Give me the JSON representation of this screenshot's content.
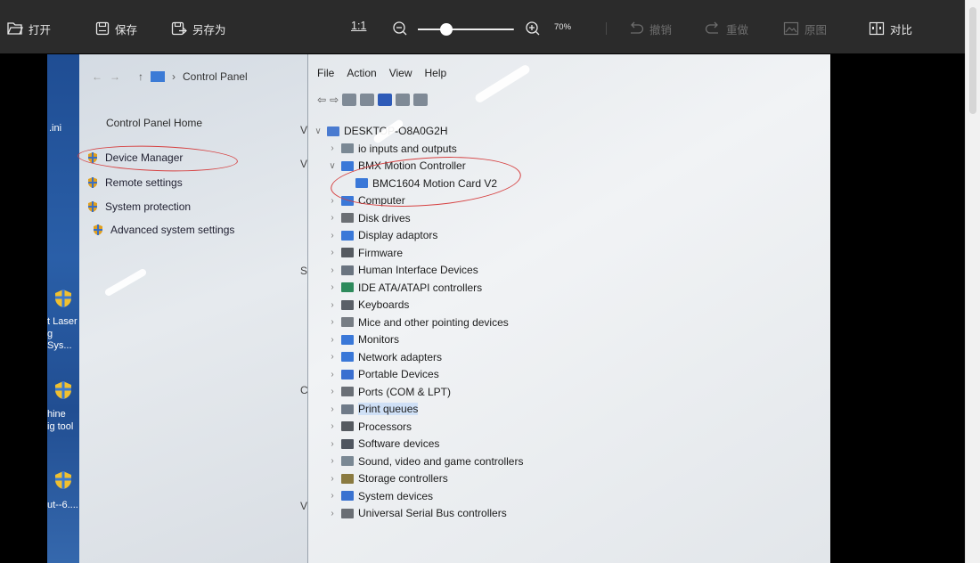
{
  "toolbar": {
    "open_label": "打开",
    "save_label": "保存",
    "save_as_label": "另存为",
    "ratio_label": "1:1",
    "zoom_percent": "70%",
    "zoom_level": 0.3,
    "undo_label": "撤销",
    "redo_label": "重做",
    "original_label": "原图",
    "compare_label": "对比"
  },
  "photo": {
    "desktop_labels": [
      ".ini",
      "t Laser",
      "g Sys...",
      "hine",
      "ig tool",
      "ut--6...."
    ],
    "control_panel": {
      "nav_path": "Control Panel",
      "home": "Control Panel Home",
      "links": [
        "Device Manager",
        "Remote settings",
        "System protection",
        "Advanced system settings"
      ],
      "edge_letters": [
        "V",
        "V",
        "S",
        "C",
        "V"
      ]
    },
    "device_manager": {
      "menu": [
        "File",
        "Action",
        "View",
        "Help"
      ],
      "tree": [
        {
          "label": "DESKTOP-O8A0G2H",
          "chev": "v",
          "indent": 0,
          "icon": "computer"
        },
        {
          "label": "    io inputs and outputs",
          "chev": ">",
          "indent": 1,
          "icon": "audio"
        },
        {
          "label": "BMX Motion Controller",
          "chev": "v",
          "indent": 1,
          "icon": "monitor"
        },
        {
          "label": "BMC1604 Motion Card V2",
          "chev": "",
          "indent": 2,
          "icon": "monitor"
        },
        {
          "label": "Computer",
          "chev": ">",
          "indent": 1,
          "icon": "monitor"
        },
        {
          "label": "Disk drives",
          "chev": ">",
          "indent": 1,
          "icon": "disk"
        },
        {
          "label": "Display adaptors",
          "chev": ">",
          "indent": 1,
          "icon": "monitor"
        },
        {
          "label": "Firmware",
          "chev": ">",
          "indent": 1,
          "icon": "chip"
        },
        {
          "label": "Human Interface Devices",
          "chev": ">",
          "indent": 1,
          "icon": "hid"
        },
        {
          "label": "IDE ATA/ATAPI controllers",
          "chev": ">",
          "indent": 1,
          "icon": "ide"
        },
        {
          "label": "Keyboards",
          "chev": ">",
          "indent": 1,
          "icon": "keyboard"
        },
        {
          "label": "Mice and other pointing devices",
          "chev": ">",
          "indent": 1,
          "icon": "mouse"
        },
        {
          "label": "Monitors",
          "chev": ">",
          "indent": 1,
          "icon": "monitor"
        },
        {
          "label": "Network adapters",
          "chev": ">",
          "indent": 1,
          "icon": "monitor"
        },
        {
          "label": "Portable Devices",
          "chev": ">",
          "indent": 1,
          "icon": "portable"
        },
        {
          "label": "Ports (COM & LPT)",
          "chev": ">",
          "indent": 1,
          "icon": "port"
        },
        {
          "label": "Print queues",
          "chev": ">",
          "indent": 1,
          "icon": "printer"
        },
        {
          "label": "Processors",
          "chev": ">",
          "indent": 1,
          "icon": "chip"
        },
        {
          "label": "Software devices",
          "chev": ">",
          "indent": 1,
          "icon": "software"
        },
        {
          "label": "Sound, video and game controllers",
          "chev": ">",
          "indent": 1,
          "icon": "audio"
        },
        {
          "label": "Storage controllers",
          "chev": ">",
          "indent": 1,
          "icon": "storage"
        },
        {
          "label": "System devices",
          "chev": ">",
          "indent": 1,
          "icon": "folder"
        },
        {
          "label": "Universal Serial Bus controllers",
          "chev": ">",
          "indent": 1,
          "icon": "usb"
        }
      ],
      "highlighted": "Print queues"
    },
    "colors": {
      "annotation_red": "#d64040",
      "toolbar_bg": "#2b2b2b",
      "desktop_blue": "#2a5fa8"
    }
  }
}
